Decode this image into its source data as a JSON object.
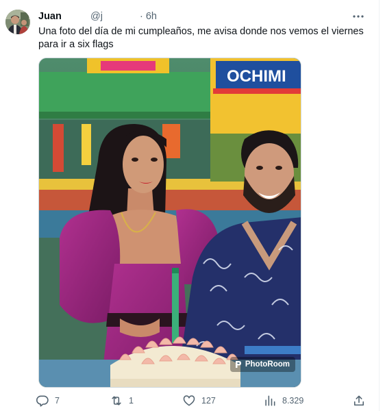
{
  "author": {
    "name": "Juan",
    "handle": "@j",
    "time": "· 6h"
  },
  "tweet": {
    "text": "Una foto del día de mi cumpleaños, me avisa donde nos vemos el viernes para ir a six flags"
  },
  "media": {
    "background_sign_text": "OCHIMI",
    "watermark": "PhotoRoom"
  },
  "actions": {
    "replies": "7",
    "retweets": "1",
    "likes": "127",
    "views": "8.329"
  },
  "colors": {
    "text": "#0f1419",
    "secondary": "#536471",
    "border": "#cfd9de"
  },
  "icons": [
    "more-icon",
    "reply-icon",
    "retweet-icon",
    "like-icon",
    "views-icon",
    "share-icon",
    "photoroom-icon"
  ]
}
